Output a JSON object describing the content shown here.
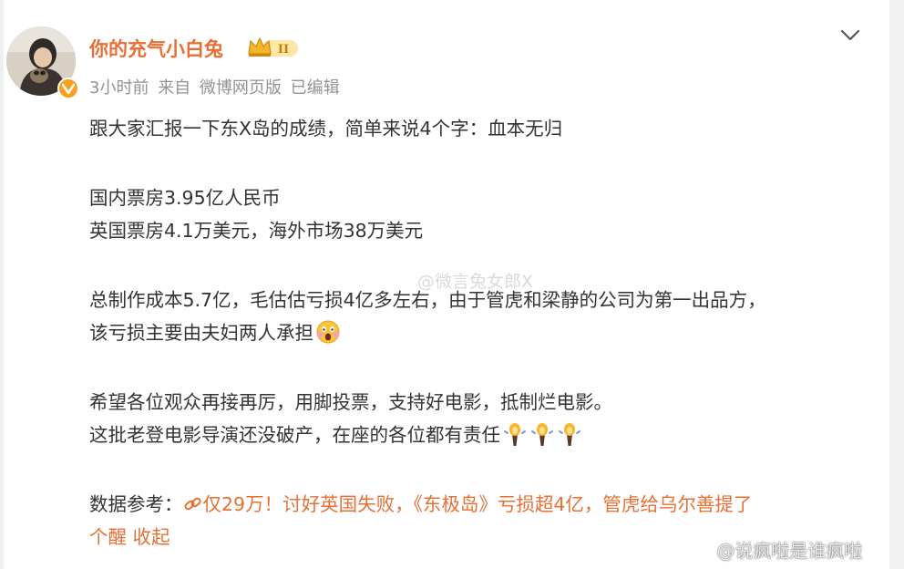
{
  "post": {
    "author": "你的充气小白兔",
    "vip_level": "II",
    "time": "3小时前",
    "source_prefix": "来自",
    "source": "微博网页版",
    "edited": "已编辑",
    "body": {
      "line1": "跟大家汇报一下东X岛的成绩，简单来说4个字：血本无归",
      "line2": "国内票房3.95亿人民币",
      "line3": "英国票房4.1万美元，海外市场38万美元",
      "line4": "总制作成本5.7亿，毛估估亏损4亿多左右，由于管虎和梁静的公司为第一出品方，",
      "line5": "该亏损主要由夫妇两人承担",
      "line6": "希望各位观众再接再厉，用脚投票，支持好电影，抵制烂电影。",
      "line7": "这批老登电影导演还没破产，在座的各位都有责任"
    },
    "reference": {
      "label": "数据参考：",
      "link_part1": "仅29万！讨好英国失败，《东极岛》亏损超4亿，管虎给乌尔善提了",
      "link_part2": "个醒",
      "collapse": "收起"
    }
  },
  "watermarks": {
    "middle": "@微言兔女郎X",
    "bottom_right": "@说疯啦是谁疯啦"
  },
  "icons": {
    "verify": "verified-badge-icon",
    "vip": "vip-crown-icon",
    "more": "chevron-down-icon",
    "link": "link-icon",
    "emoji_shocked": "shocked-face-emoji-icon",
    "emoji_torch": "torch-emoji-icon"
  },
  "colors": {
    "accent": "#e86f33",
    "text": "#333333",
    "meta": "#939393",
    "verify": "#f7a01d"
  }
}
